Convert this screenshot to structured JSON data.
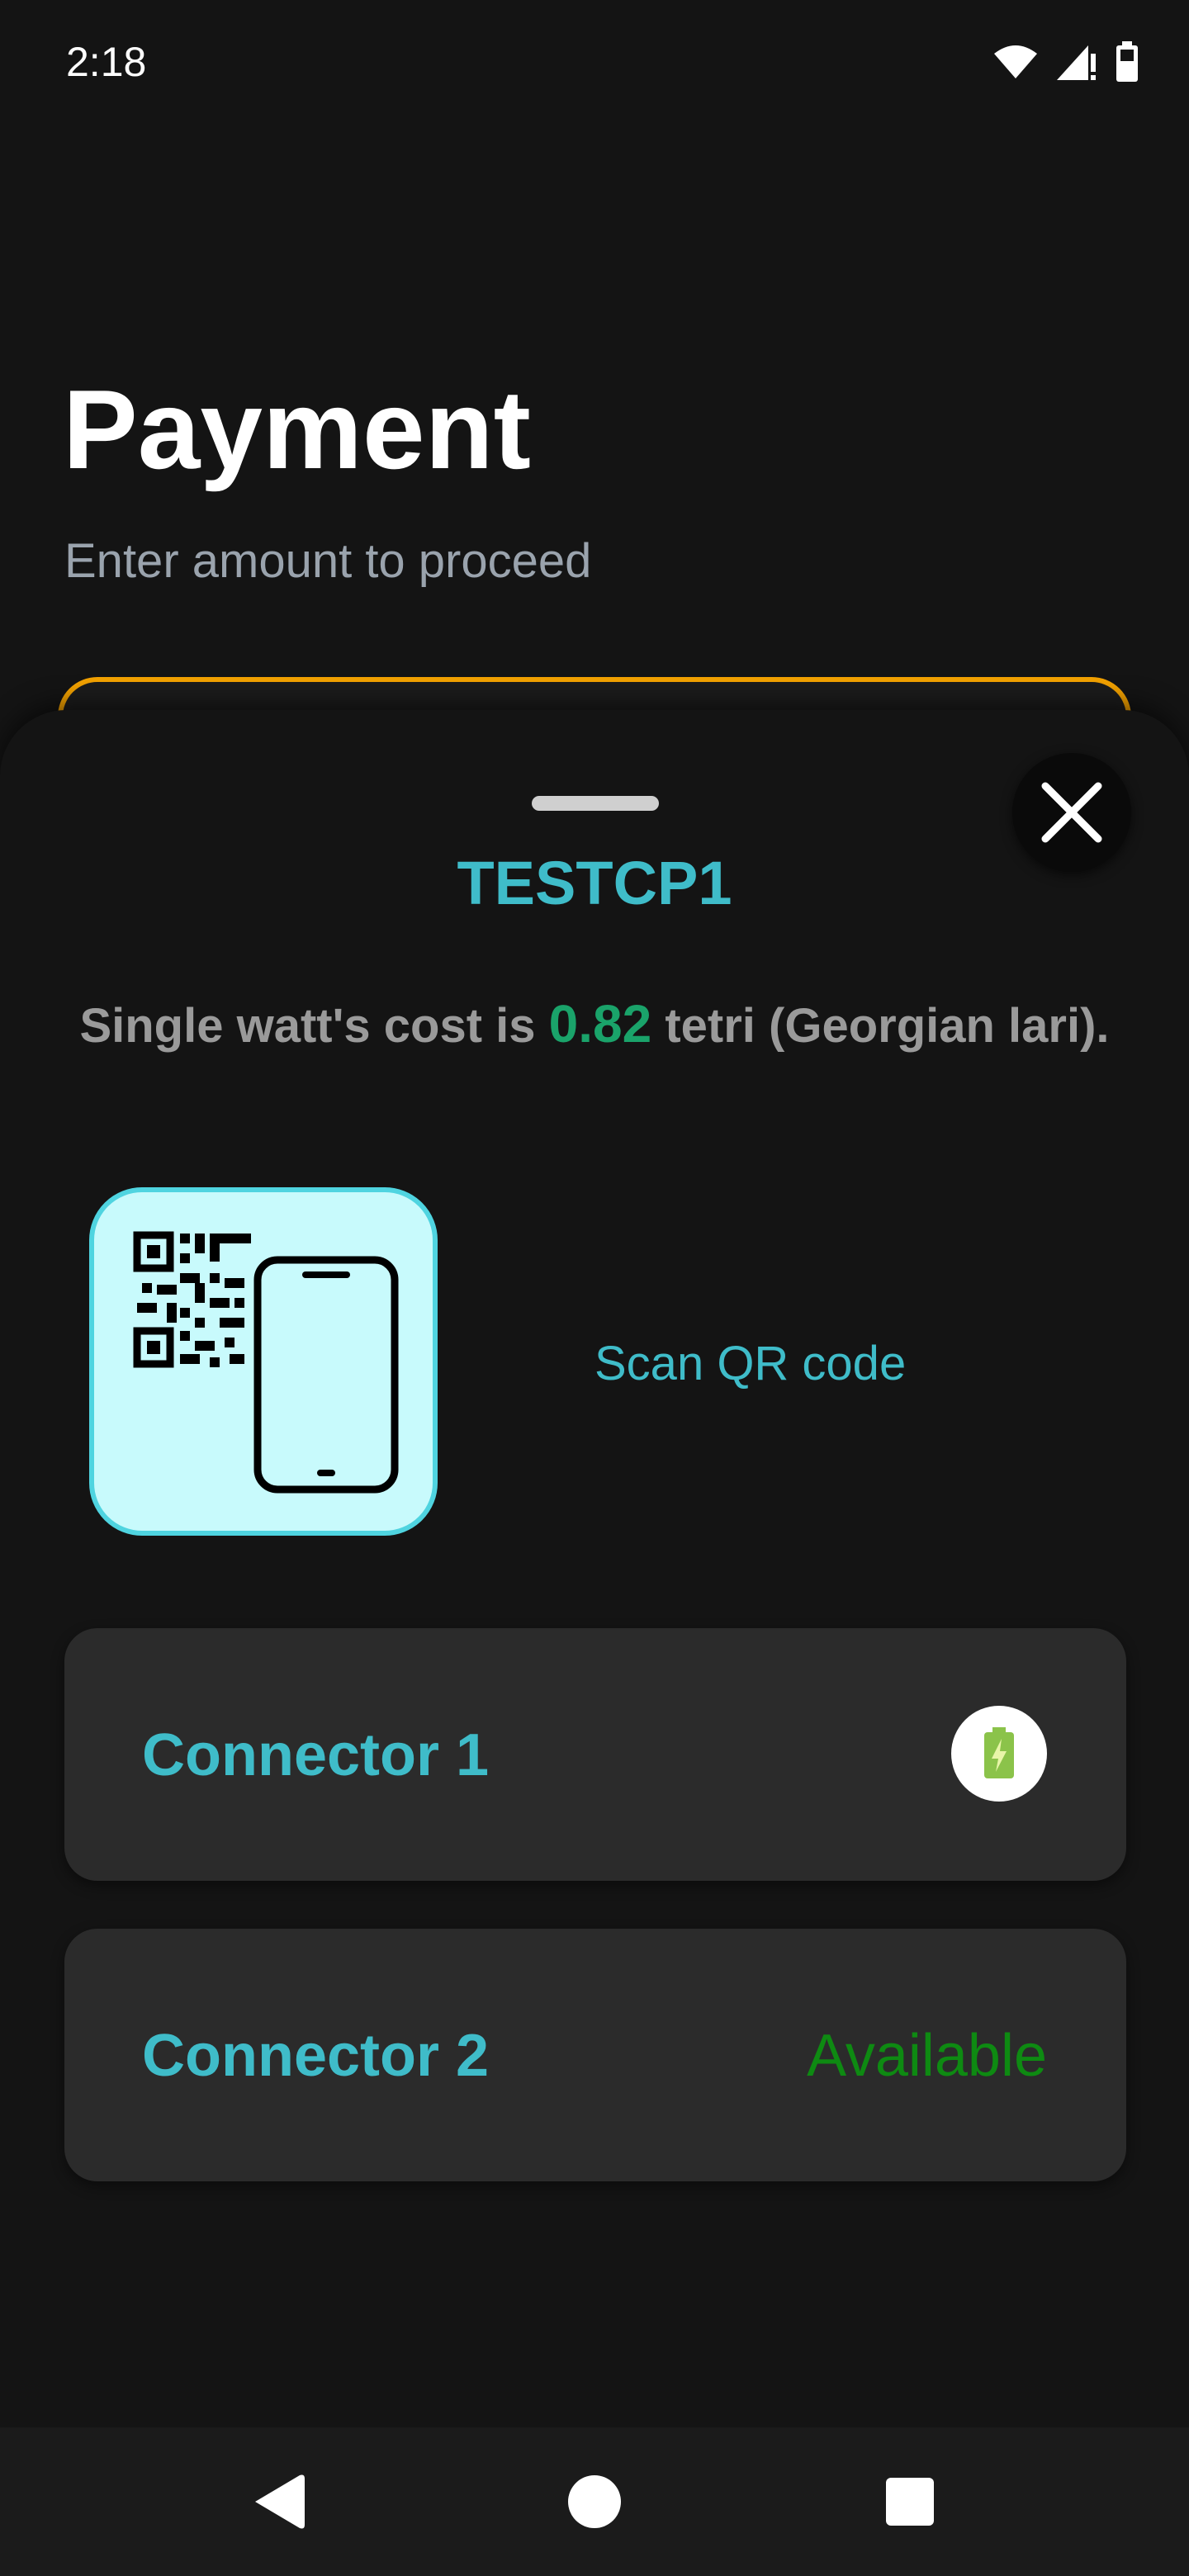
{
  "status_bar": {
    "time": "2:18",
    "icons": [
      "wifi-icon",
      "cellular-signal-icon",
      "battery-icon"
    ]
  },
  "page": {
    "title": "Payment",
    "subtitle": "Enter amount to proceed"
  },
  "sheet": {
    "station_name": "TESTCP1",
    "cost": {
      "prefix": "Single watt's cost is",
      "value": "0.82",
      "suffix": "tetri (Georgian lari)."
    },
    "qr": {
      "label": "Scan QR code"
    },
    "connectors": [
      {
        "name": "Connector 1",
        "status_icon": "charging-battery-icon"
      },
      {
        "name": "Connector 2",
        "status": "Available"
      }
    ]
  },
  "nav_bar": {
    "icons": [
      "back-icon",
      "home-icon",
      "recents-icon"
    ]
  },
  "colors": {
    "accent": "#3fbcc9",
    "cost_value": "#1aa36a",
    "available": "#0e8a12",
    "amount_border": "#f2a100",
    "qr_tile_bg": "#c8fafc"
  }
}
